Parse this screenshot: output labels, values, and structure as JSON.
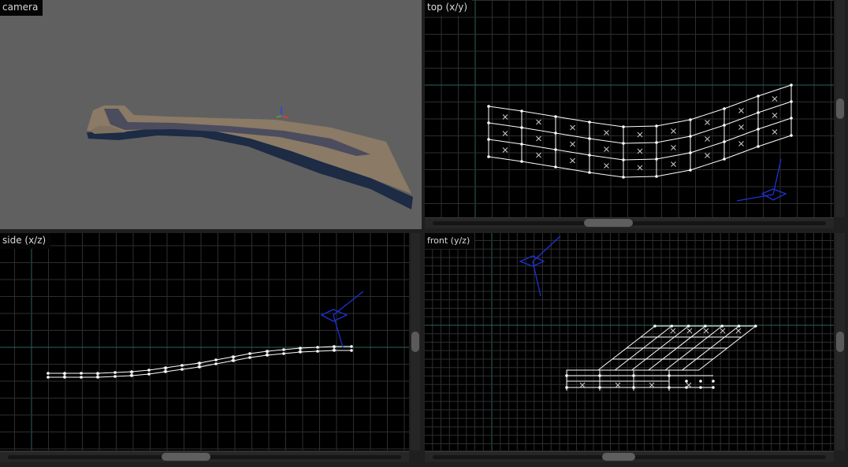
{
  "viewports": {
    "camera": {
      "label": "camera"
    },
    "top": {
      "label": "top (x/y)"
    },
    "side": {
      "label": "side (x/z)"
    },
    "front": {
      "label": "front (y/z)"
    }
  },
  "colors": {
    "camera_bg": "#606060",
    "ortho_bg": "#000000",
    "grid": "#2e2e2e",
    "grid_axis": "#2f5f5f",
    "wire": "#ffffff",
    "gizmo": "#1e32d2"
  },
  "icons": [
    "axis-gizmo-icon",
    "camera-gizmo-icon",
    "control-point-icon"
  ]
}
